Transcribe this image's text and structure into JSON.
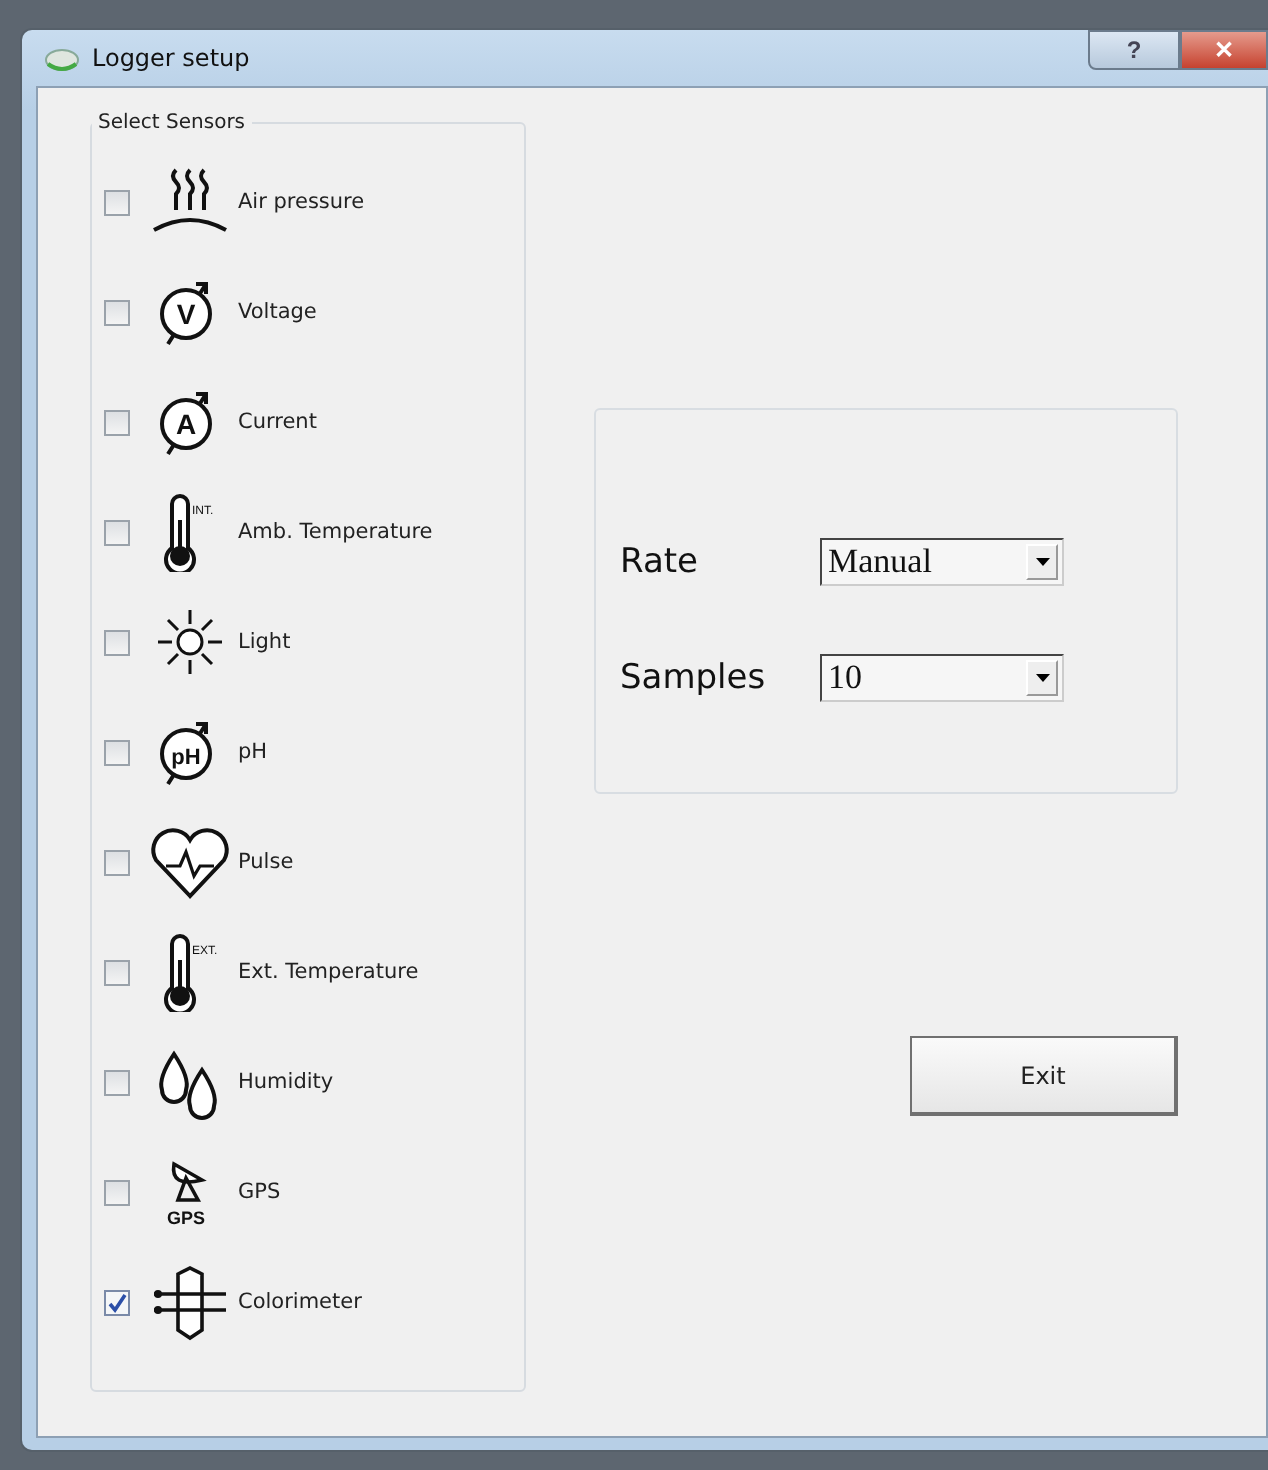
{
  "window": {
    "title": "Logger setup",
    "help_button": "?",
    "close_button": "✕"
  },
  "sensors_group": {
    "title": "Select Sensors",
    "sensors": [
      {
        "kind": "pressure",
        "label": "Air pressure",
        "checked": false
      },
      {
        "kind": "meter",
        "icon_text": "V",
        "label": "Voltage",
        "checked": false
      },
      {
        "kind": "meter",
        "icon_text": "A",
        "label": "Current",
        "checked": false
      },
      {
        "kind": "thermometer",
        "icon_text": "INT.",
        "label": "Amb. Temperature",
        "checked": false
      },
      {
        "kind": "sun",
        "label": "Light",
        "checked": false
      },
      {
        "kind": "meter",
        "icon_text": "pH",
        "label": "pH",
        "checked": false
      },
      {
        "kind": "heart",
        "label": "Pulse",
        "checked": false
      },
      {
        "kind": "thermometer",
        "icon_text": "EXT.",
        "label": "Ext. Temperature",
        "checked": false
      },
      {
        "kind": "drops",
        "label": "Humidity",
        "checked": false
      },
      {
        "kind": "dish",
        "icon_text": "GPS",
        "label": "GPS",
        "checked": false
      },
      {
        "kind": "cuvette",
        "label": "Colorimeter",
        "checked": true
      }
    ]
  },
  "settings": [
    {
      "label": "Rate",
      "value": "Manual"
    },
    {
      "label": "Samples",
      "value": "10"
    }
  ],
  "exit_button": "Exit"
}
